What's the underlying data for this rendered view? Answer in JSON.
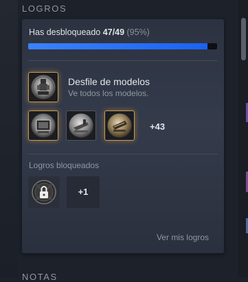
{
  "section": {
    "title": "LOGROS",
    "next_title": "NOTAS"
  },
  "progress": {
    "label_prefix": "Has desbloqueado",
    "count": "47/49",
    "percent_text": "(95%)",
    "fraction": 0.95
  },
  "featured": {
    "title": "Desfile de modelos",
    "description": "Ve todos los modelos.",
    "icon": "robot-statue-icon"
  },
  "unlocked_row": {
    "icons": [
      "picture-frame-icon",
      "sewing-machine-icon",
      "crate-icon"
    ],
    "more": "+43"
  },
  "locked": {
    "label": "Logros bloqueados",
    "icon": "padlock-icon",
    "more": "+1"
  },
  "footer": {
    "link": "Ver mis logros"
  },
  "colors": {
    "accent": "#1a62f1",
    "gold_border": "#c99a4c"
  }
}
